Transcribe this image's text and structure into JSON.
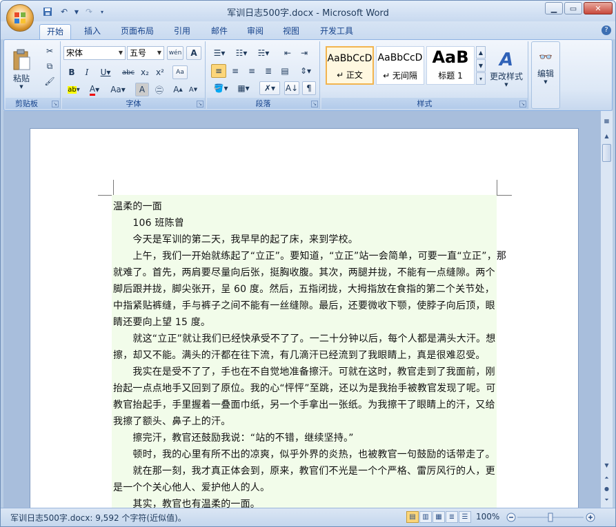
{
  "window": {
    "title": "军训日志500字.docx - Microsoft Word"
  },
  "qat": {
    "save_icon": "save-icon",
    "undo_icon": "undo-icon",
    "redo_icon": "redo-icon"
  },
  "tabs": [
    {
      "label": "开始",
      "active": true
    },
    {
      "label": "插入"
    },
    {
      "label": "页面布局"
    },
    {
      "label": "引用"
    },
    {
      "label": "邮件"
    },
    {
      "label": "审阅"
    },
    {
      "label": "视图"
    },
    {
      "label": "开发工具"
    }
  ],
  "ribbon": {
    "clipboard": {
      "label": "剪贴板",
      "paste": "粘贴"
    },
    "font": {
      "label": "字体",
      "font_name": "宋体",
      "font_size": "五号",
      "phonetic": "wén",
      "char_border": "A"
    },
    "paragraph": {
      "label": "段落"
    },
    "styles": {
      "label": "样式",
      "items": [
        {
          "sample": "AaBbCcD",
          "name": "↵ 正文",
          "selected": true
        },
        {
          "sample": "AaBbCcD",
          "name": "↵ 无间隔"
        },
        {
          "sample": "AaB",
          "name": "标题 1"
        }
      ],
      "change": "更改样式"
    },
    "editing": {
      "label": "编辑"
    }
  },
  "document": {
    "lines": [
      "温柔的一面",
      "　　106 班陈曾",
      "　　今天是军训的第二天，我早早的起了床，来到学校。",
      "　　上午，我们一开始就练起了“立正”。要知道，“立正”站一会简单，可要一直“立正”，那",
      "就难了。首先，两肩要尽量向后张，挺胸收腹。其次，两腿并拢，不能有一点缝隙。两个",
      "脚后跟并拢，脚尖张开，呈 60 度。然后，五指闭拢，大拇指放在食指的第二个关节处，",
      "中指紧贴裤缝，手与裤子之间不能有一丝缝隙。最后，还要微收下颚，使脖子向后顶，眼",
      "睛还要向上望 15 度。",
      "　　就这“立正”就让我们已经快承受不了了。一二十分钟以后，每个人都是满头大汗。想",
      "擦，却又不能。满头的汗都在往下流，有几滴汗已经流到了我眼睛上，真是很难忍受。",
      "　　我实在是受不了了，手也在不自觉地准备擦汗。可就在这时，教官走到了我面前，刚",
      "抬起一点点地手又回到了原位。我的心“怦怦”至跳，还以为是我抬手被教官发现了呢。可",
      "教官抬起手，手里握着一叠面巾纸，另一个手拿出一张纸。为我擦干了眼睛上的汗，又给",
      "我擦了额头、鼻子上的汗。",
      "　　擦完汗，教官还鼓励我说：“站的不错，继续坚持。”",
      "　　顿时，我的心里有所不出的凉爽，似乎外界的炎热，也被教官一句鼓励的话带走了。",
      "　　就在那一刻，我才真正体会到，原来，教官们不光是一个个严格、雷厉风行的人，更",
      "是一个个关心他人、爱护他人的人。",
      "　　其实，教官也有温柔的一面。"
    ]
  },
  "status": {
    "text": "军训日志500字.docx: 9,592 个字符(近似值)。",
    "zoom": "100%"
  }
}
